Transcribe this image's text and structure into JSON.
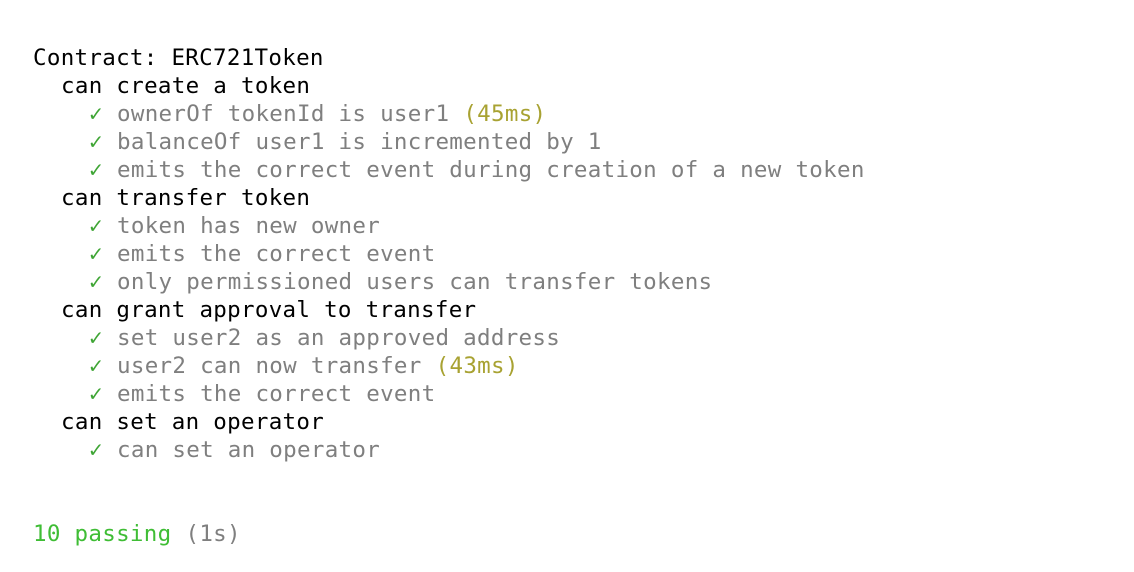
{
  "contract_label": "Contract: ERC721Token",
  "check_glyph": "✓",
  "suites": [
    {
      "title": "can create a token",
      "tests": [
        {
          "name": "ownerOf tokenId is user1",
          "duration": "(45ms)"
        },
        {
          "name": "balanceOf user1 is incremented by 1",
          "duration": ""
        },
        {
          "name": "emits the correct event during creation of a new token",
          "duration": ""
        }
      ]
    },
    {
      "title": "can transfer token",
      "tests": [
        {
          "name": "token has new owner",
          "duration": ""
        },
        {
          "name": "emits the correct event",
          "duration": ""
        },
        {
          "name": "only permissioned users can transfer tokens",
          "duration": ""
        }
      ]
    },
    {
      "title": "can grant approval to transfer",
      "tests": [
        {
          "name": "set user2 as an approved address",
          "duration": ""
        },
        {
          "name": "user2 can now transfer",
          "duration": "(43ms)"
        },
        {
          "name": "emits the correct event",
          "duration": ""
        }
      ]
    },
    {
      "title": "can set an operator",
      "tests": [
        {
          "name": "can set an operator",
          "duration": ""
        }
      ]
    }
  ],
  "summary": {
    "passing": "10 passing",
    "time": "(1s)"
  },
  "colors": {
    "check": "#3fa535",
    "test_text": "#7f7f7f",
    "duration": "#a8a232",
    "passing": "#3fbd35"
  }
}
